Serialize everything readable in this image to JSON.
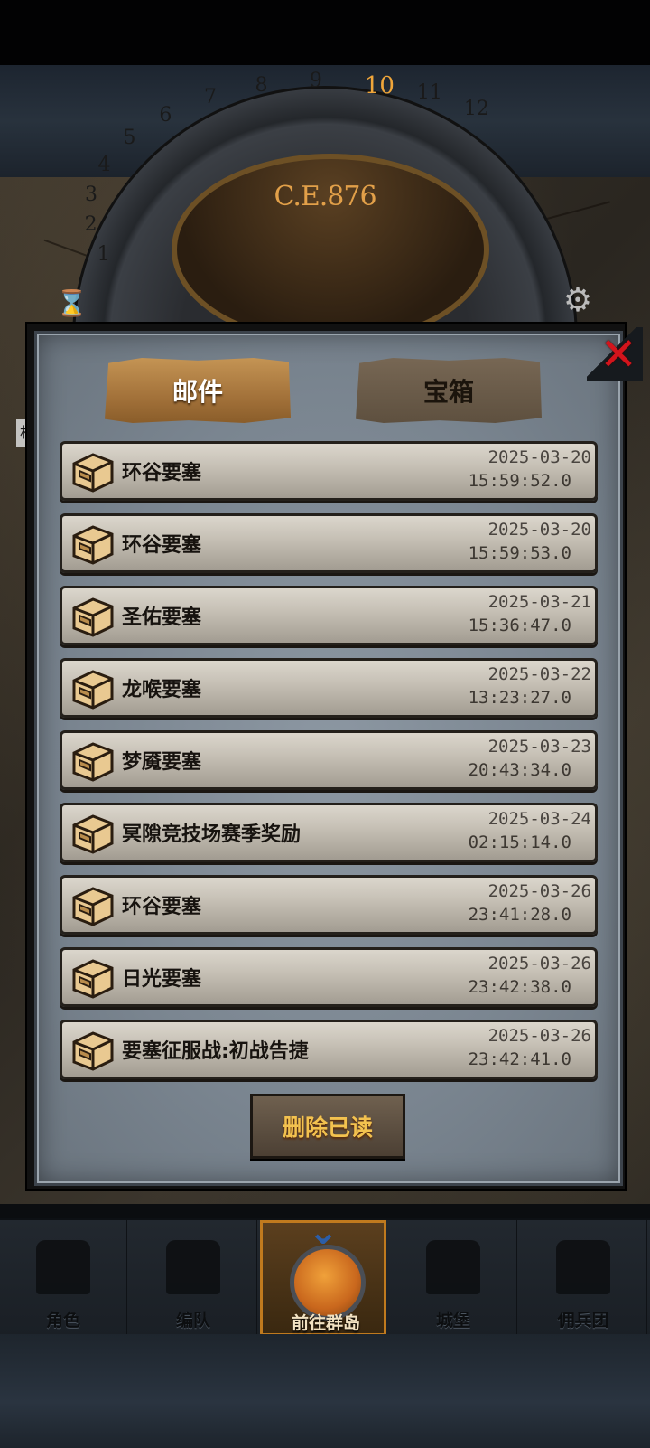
{
  "header": {
    "era_year": "C.E.876",
    "dial_numbers": [
      "1",
      "2",
      "3",
      "4",
      "5",
      "6",
      "7",
      "8",
      "9",
      "10",
      "11",
      "12"
    ],
    "active_hour": "10",
    "location_label": "村"
  },
  "tabs": [
    {
      "label": "邮件",
      "active": true
    },
    {
      "label": "宝箱",
      "active": false
    }
  ],
  "mails": [
    {
      "title": "环谷要塞",
      "date": "2025-03-20",
      "time": "15:59:52.0"
    },
    {
      "title": "环谷要塞",
      "date": "2025-03-20",
      "time": "15:59:53.0"
    },
    {
      "title": "圣佑要塞",
      "date": "2025-03-21",
      "time": "15:36:47.0"
    },
    {
      "title": "龙喉要塞",
      "date": "2025-03-22",
      "time": "13:23:27.0"
    },
    {
      "title": "梦魇要塞",
      "date": "2025-03-23",
      "time": "20:43:34.0"
    },
    {
      "title": "冥隙竞技场赛季奖励",
      "date": "2025-03-24",
      "time": "02:15:14.0"
    },
    {
      "title": "环谷要塞",
      "date": "2025-03-26",
      "time": "23:41:28.0"
    },
    {
      "title": "日光要塞",
      "date": "2025-03-26",
      "time": "23:42:38.0"
    },
    {
      "title": "要塞征服战:初战告捷",
      "date": "2025-03-26",
      "time": "23:42:41.0"
    }
  ],
  "delete_read_label": "删除已读",
  "bottom_nav": [
    {
      "label": "角色",
      "icon": "knight-icon",
      "active": false
    },
    {
      "label": "编队",
      "icon": "squad-icon",
      "active": false
    },
    {
      "label": "前往群岛",
      "icon": "island-icon",
      "active": true
    },
    {
      "label": "城堡",
      "icon": "castle-icon",
      "active": false
    },
    {
      "label": "佣兵团",
      "icon": "mercenary-icon",
      "active": false
    }
  ],
  "colors": {
    "accent_gold": "#f3c24f",
    "close_red": "#d3141c",
    "tab_active": "#b8864a",
    "nav_active_border": "#c07a1e"
  }
}
